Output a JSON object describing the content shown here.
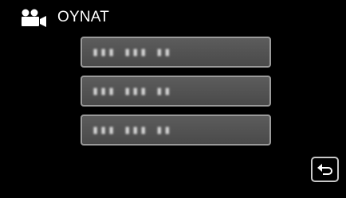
{
  "header": {
    "icon": "video-camera-icon",
    "title": "OYNAT"
  },
  "menu": {
    "items": [
      {
        "label": "▮▮▮ ▮▮▮ ▮▮"
      },
      {
        "label": "▮▮▮ ▮▮▮ ▮▮"
      },
      {
        "label": "▮▮▮ ▮▮▮ ▮▮"
      }
    ]
  },
  "footer": {
    "back_icon": "return-arrow-icon"
  },
  "colors": {
    "background": "#000000",
    "button_fill": "#555555",
    "button_border": "#9a9a9a",
    "text": "#ffffff"
  }
}
